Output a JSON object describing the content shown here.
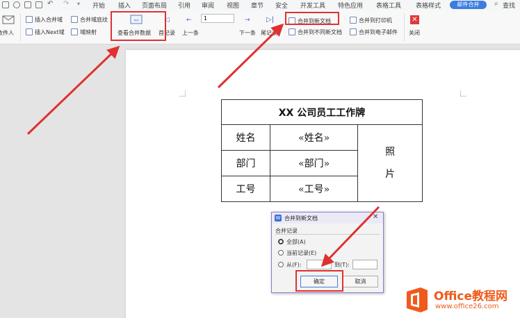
{
  "menu": {
    "tabs": [
      "开始",
      "插入",
      "页面布局",
      "引用",
      "审阅",
      "视图",
      "章节",
      "安全",
      "开发工具",
      "特色应用",
      "表格工具",
      "表格样式"
    ],
    "active_tab": "邮件合并",
    "search": "查找"
  },
  "ribbon": {
    "recipients": "收件人",
    "insert_merge_field": "插入合并域",
    "merge_field_shading": "合并域底纹",
    "insert_next_field": "插入Next域",
    "field_mapping": "域映射",
    "view_merged_data": "查看合并数据",
    "first_record": "首记录",
    "prev_record": "上一条",
    "record_number": "1",
    "next_record": "下一条",
    "last_record": "尾记录",
    "merge_to_new_doc": "合并到新文档",
    "merge_to_different_docs": "合并到不同新文档",
    "merge_to_printer": "合并到打印机",
    "merge_to_email": "合并到电子邮件",
    "close": "关闭"
  },
  "badge": {
    "title": "XX 公司员工工作牌",
    "rows": [
      {
        "label": "姓名",
        "value": "«姓名»"
      },
      {
        "label": "部门",
        "value": "«部门»"
      },
      {
        "label": "工号",
        "value": "«工号»"
      }
    ],
    "photo": [
      "照",
      "片"
    ]
  },
  "dialog": {
    "title": "合并到新文档",
    "group_label": "合并记录",
    "opt_all": "全部(A)",
    "opt_current": "当前记录(E)",
    "opt_from": "从(F):",
    "to_label": "到(T):",
    "ok": "确定",
    "cancel": "取消"
  },
  "watermark": {
    "brand": "Office教程网",
    "url": "www.office26.com"
  },
  "colors": {
    "accent": "#3b7de0",
    "annotation_red": "#e03030",
    "dialog_border": "#8c7cc9",
    "logo_orange": "#f05a1a"
  }
}
